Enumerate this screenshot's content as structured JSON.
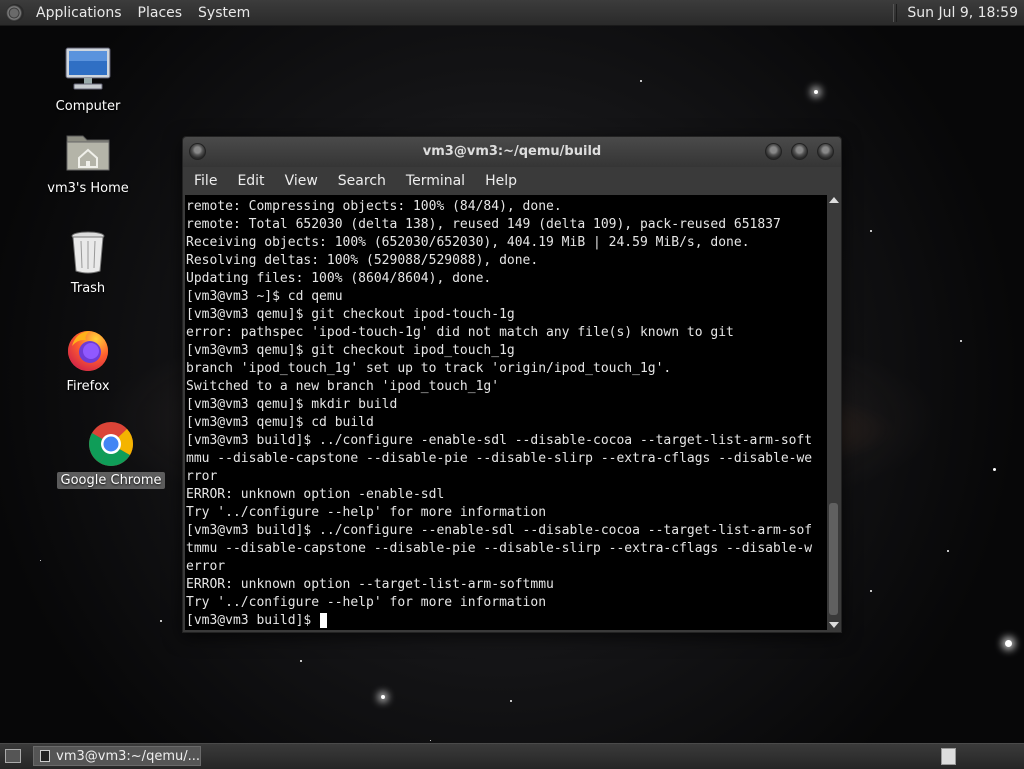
{
  "top_panel": {
    "applications": "Applications",
    "places": "Places",
    "system": "System",
    "clock": "Sun Jul  9, 18:59"
  },
  "desktop": {
    "computer": "Computer",
    "home": "vm3's Home",
    "trash": "Trash",
    "firefox": "Firefox",
    "chrome": "Google Chrome"
  },
  "terminal": {
    "title": "vm3@vm3:~/qemu/build",
    "menu": [
      "File",
      "Edit",
      "View",
      "Search",
      "Terminal",
      "Help"
    ],
    "lines": [
      "remote: Compressing objects: 100% (84/84), done.",
      "remote: Total 652030 (delta 138), reused 149 (delta 109), pack-reused 651837",
      "Receiving objects: 100% (652030/652030), 404.19 MiB | 24.59 MiB/s, done.",
      "Resolving deltas: 100% (529088/529088), done.",
      "Updating files: 100% (8604/8604), done.",
      "[vm3@vm3 ~]$ cd qemu",
      "[vm3@vm3 qemu]$ git checkout ipod-touch-1g",
      "error: pathspec 'ipod-touch-1g' did not match any file(s) known to git",
      "[vm3@vm3 qemu]$ git checkout ipod_touch_1g",
      "branch 'ipod_touch_1g' set up to track 'origin/ipod_touch_1g'.",
      "Switched to a new branch 'ipod_touch_1g'",
      "[vm3@vm3 qemu]$ mkdir build",
      "[vm3@vm3 qemu]$ cd build",
      "[vm3@vm3 build]$ ../configure -enable-sdl --disable-cocoa --target-list-arm-soft",
      "mmu --disable-capstone --disable-pie --disable-slirp --extra-cflags --disable-we",
      "rror",
      "ERROR: unknown option -enable-sdl",
      "Try '../configure --help' for more information",
      "[vm3@vm3 build]$ ../configure --enable-sdl --disable-cocoa --target-list-arm-sof",
      "tmmu --disable-capstone --disable-pie --disable-slirp --extra-cflags --disable-w",
      "error",
      "ERROR: unknown option --target-list-arm-softmmu",
      "Try '../configure --help' for more information"
    ],
    "prompt": "[vm3@vm3 build]$ "
  },
  "bottom_panel": {
    "task_label": "vm3@vm3:~/qemu/..."
  },
  "colors": {
    "panel": "#2f2f2f",
    "terminal_bg": "#000000",
    "terminal_fg": "#e6e6e6"
  }
}
